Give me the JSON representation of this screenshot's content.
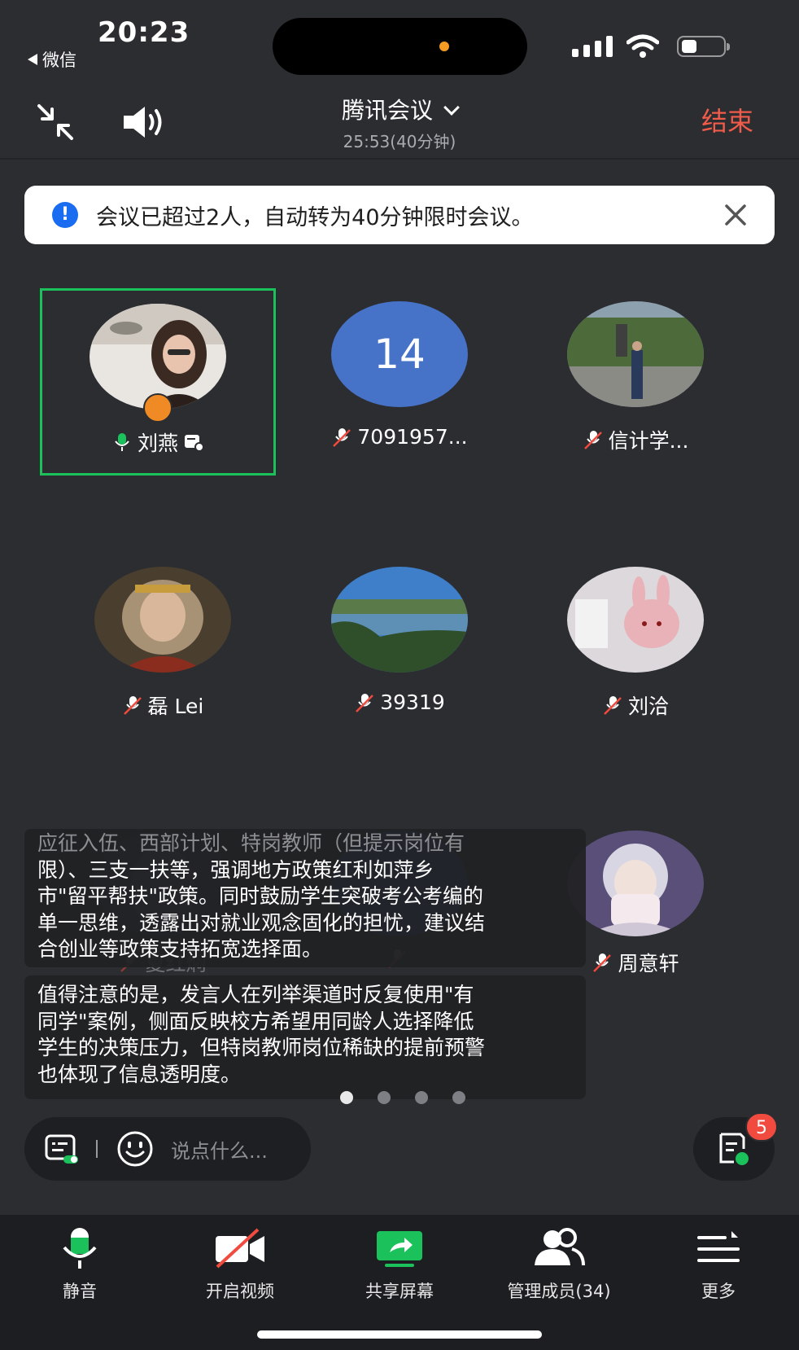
{
  "status_bar": {
    "time": "20:23",
    "back_app": "微信"
  },
  "header": {
    "title": "腾讯会议",
    "timer": "25:53(40分钟)",
    "end_label": "结束"
  },
  "notice": {
    "text": "会议已超过2人，自动转为40分钟限时会议。"
  },
  "participants": [
    {
      "name": "刘燕",
      "mic": "on",
      "host": true,
      "avatar": "photo"
    },
    {
      "name": "7091957...",
      "mic": "muted",
      "avatar": "14"
    },
    {
      "name": "信计学...",
      "mic": "muted",
      "avatar": "photo"
    },
    {
      "name": "磊 Lei",
      "mic": "muted",
      "avatar": "photo"
    },
    {
      "name": "39319",
      "mic": "muted",
      "avatar": "photo"
    },
    {
      "name": "刘洽",
      "mic": "muted",
      "avatar": "photo"
    },
    {
      "name": "夏红焖",
      "mic": "muted",
      "avatar": "photo"
    },
    {
      "name": "",
      "mic": "muted",
      "avatar": "photo"
    },
    {
      "name": "周意轩",
      "mic": "muted",
      "avatar": "photo"
    }
  ],
  "captions": {
    "first": [
      "应征入伍、西部计划、特岗教师（但提示岗位有",
      "限）、三支一扶等，强调地方政策红利如萍乡",
      "市\"留平帮扶\"政策。同时鼓励学生突破考公考编的",
      "单一思维，透露出对就业观念固化的担忧，建议结",
      "合创业等政策支持拓宽选择面。"
    ],
    "second": [
      "值得注意的是，发言人在列举渠道时反复使用\"有",
      "同学\"案例，侧面反映校方希望用同龄人选择降低",
      "学生的决策压力，但特岗教师岗位稀缺的提前预警",
      "也体现了信息透明度。"
    ]
  },
  "pager": {
    "pages": 4,
    "current": 1
  },
  "input": {
    "placeholder": "说点什么..."
  },
  "notes_badge": "5",
  "toolbar": {
    "mute": "静音",
    "video": "开启视频",
    "share": "共享屏幕",
    "members": "管理成员(34)",
    "more": "更多"
  },
  "colors": {
    "accent_green": "#1bc15b",
    "end_red": "#f05b4a",
    "badge_red": "#f04b3e",
    "number_avatar": "#4672c8"
  }
}
